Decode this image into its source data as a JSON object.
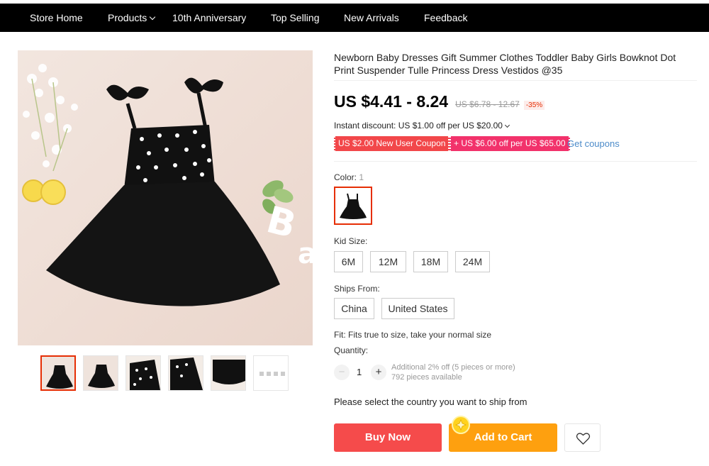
{
  "nav": {
    "items": [
      "Store Home",
      "Products",
      "10th Anniversary",
      "Top Selling",
      "New Arrivals",
      "Feedback"
    ]
  },
  "product": {
    "title": "Newborn Baby Dresses Gift Summer Clothes Toddler Baby Girls Bowknot Dot Print Suspender Tulle Princess Dress Vestidos @35",
    "price": "US $4.41 - 8.24",
    "original_price": "US $6.78 - 12.67",
    "discount": "-35%",
    "instant_discount": "Instant discount: US $1.00 off per US $20.00",
    "coupons": [
      "US $2.00 New User Coupon",
      "+ US $6.00 off per US $65.00"
    ],
    "get_coupons": "Get coupons"
  },
  "options": {
    "color_label": "Color:",
    "color_count": "1",
    "kid_size_label": "Kid Size:",
    "sizes": [
      "6M",
      "12M",
      "18M",
      "24M"
    ],
    "ships_from_label": "Ships From:",
    "ships_from": [
      "China",
      "United States"
    ],
    "fit": "Fit: Fits true to size, take your normal size"
  },
  "quantity": {
    "label": "Quantity:",
    "value": "1",
    "minus": "−",
    "plus": "+",
    "note_line1": "Additional 2% off (5 pieces or more)",
    "note_line2": "792 pieces available"
  },
  "shipping_prompt": "Please select the country you want to ship from",
  "actions": {
    "buy_now": "Buy Now",
    "add_to_cart": "Add to Cart"
  },
  "colors": {
    "price_red": "#e62e04",
    "buy_now_bg": "#f54b4b",
    "add_to_cart_bg": "#fea00f",
    "coupon1_bg": "#f2474a",
    "coupon2_bg": "#f2326b",
    "link_blue": "#4c8bc9"
  },
  "icons": [
    "chevron-down-icon",
    "heart-icon",
    "coin-badge-icon"
  ]
}
